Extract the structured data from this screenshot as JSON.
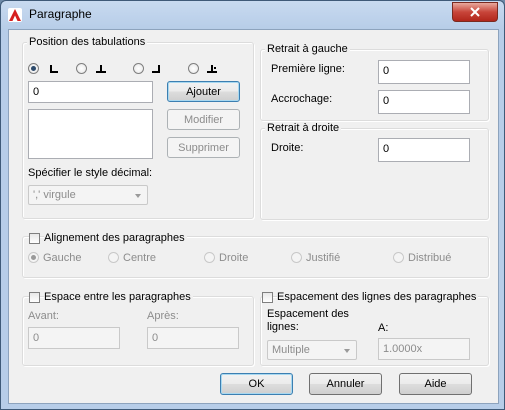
{
  "window": {
    "title": "Paragraphe"
  },
  "tab_group": {
    "title": "Position des tabulations",
    "tab_types": [
      {
        "name": "left",
        "checked": true
      },
      {
        "name": "center",
        "checked": false
      },
      {
        "name": "right",
        "checked": false
      },
      {
        "name": "decimal",
        "checked": false
      }
    ],
    "position_value": "0",
    "add_label": "Ajouter",
    "modify_label": "Modifier",
    "delete_label": "Supprimer",
    "decimal_style_label": "Spécifier le style décimal:",
    "decimal_style_value": "',' virgule"
  },
  "left_indent": {
    "title": "Retrait à gauche",
    "first_line_label": "Première ligne:",
    "first_line_value": "0",
    "hanging_label": "Accrochage:",
    "hanging_value": "0"
  },
  "right_indent": {
    "title": "Retrait à droite",
    "right_label": "Droite:",
    "right_value": "0"
  },
  "alignment": {
    "title": "Alignement des paragraphes",
    "options": [
      "Gauche",
      "Centre",
      "Droite",
      "Justifié",
      "Distribué"
    ],
    "selected": "Gauche"
  },
  "paragraph_spacing": {
    "title": "Espace entre les paragraphes",
    "before_label": "Avant:",
    "before_value": "0",
    "after_label": "Après:",
    "after_value": "0"
  },
  "line_spacing": {
    "title": "Espacement des lignes des paragraphes",
    "spacing_label": "Espacement des lignes:",
    "spacing_value": "Multiple",
    "at_label": "A:",
    "at_value": "1.0000x"
  },
  "footer": {
    "ok_label": "OK",
    "cancel_label": "Annuler",
    "help_label": "Aide"
  },
  "colors": {
    "close_button": "#c8453a",
    "app_icon": "#d61f1f"
  }
}
